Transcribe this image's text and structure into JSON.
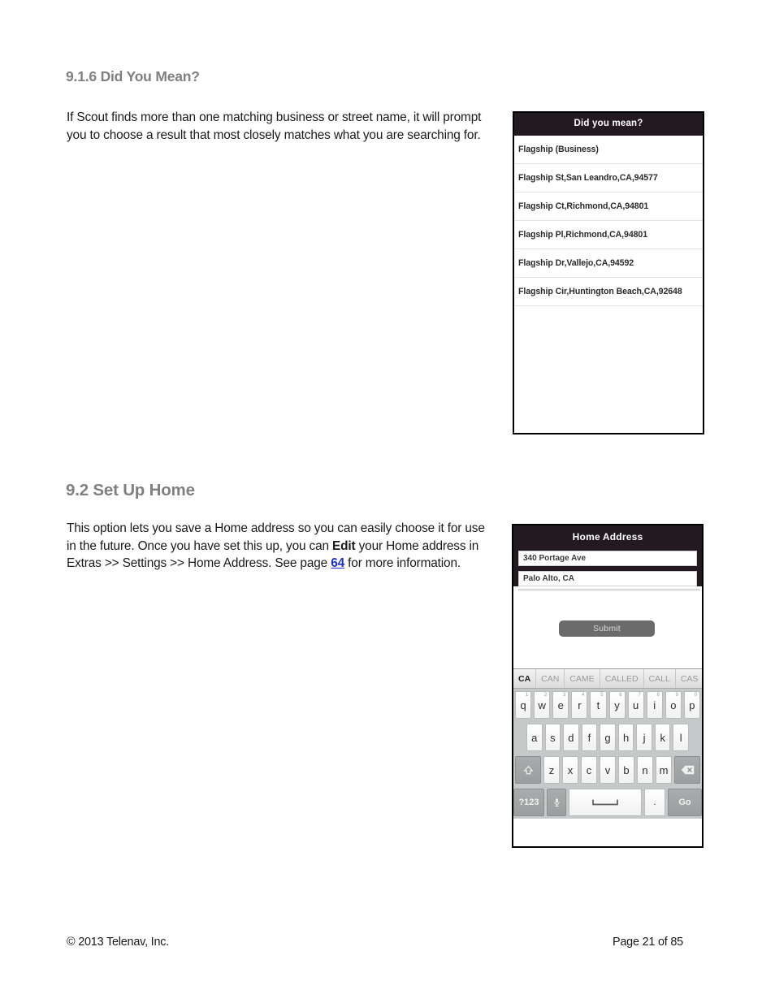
{
  "document": {
    "sections": [
      {
        "number_title": "9.1.6 Did You Mean?",
        "paragraph": "If Scout finds more than one matching business or street name, it will prompt you to choose a result that most closely matches what you are searching for."
      },
      {
        "number_title": "9.2 Set Up Home",
        "paragraph_part1": "This option lets you save a Home address so you can easily choose it for use in the future. Once you have set this up, you can ",
        "paragraph_bold": "Edit",
        "paragraph_part2": " your Home address in Extras >> Settings >> Home Address. See page ",
        "page_link": "64",
        "paragraph_part3": " for more information."
      }
    ],
    "footer": {
      "copyright": "© 2013 Telenav, Inc.",
      "page_number": "Page 21 of 85"
    }
  },
  "screenshot_did_you_mean": {
    "header_title": "Did you mean?",
    "results": [
      "Flagship (Business)",
      "Flagship St,San Leandro,CA,94577",
      "Flagship Ct,Richmond,CA,94801",
      "Flagship Pl,Richmond,CA,94801",
      "Flagship Dr,Vallejo,CA,94592",
      "Flagship Cir,Huntington Beach,CA,92648"
    ]
  },
  "screenshot_home_address": {
    "header_title": "Home Address",
    "address_field_value": "340 Portage Ave",
    "city_field_value": "Palo Alto, CA",
    "autocomplete_suggestion": "PALO ALTO, CA",
    "submit_label": "Submit",
    "keyboard": {
      "suggestions": [
        "CA",
        "CAN",
        "CAME",
        "CALLED",
        "CALL",
        "CAS",
        "..."
      ],
      "active_suggestion": "CA",
      "row1": [
        {
          "key": "q",
          "num": "1"
        },
        {
          "key": "w",
          "num": "2"
        },
        {
          "key": "e",
          "num": "3"
        },
        {
          "key": "r",
          "num": "4"
        },
        {
          "key": "t",
          "num": "5"
        },
        {
          "key": "y",
          "num": "6"
        },
        {
          "key": "u",
          "num": "7"
        },
        {
          "key": "i",
          "num": "8"
        },
        {
          "key": "o",
          "num": "9"
        },
        {
          "key": "p",
          "num": "0"
        }
      ],
      "row2": [
        "a",
        "s",
        "d",
        "f",
        "g",
        "h",
        "j",
        "k",
        "l"
      ],
      "row3": [
        "z",
        "x",
        "c",
        "v",
        "b",
        "n",
        "m"
      ],
      "shift_label": "shift-icon",
      "backspace_label": "backspace-icon",
      "symbols_label": "?123",
      "mic_label": "microphone-icon",
      "space_label": "space-icon",
      "period_label": ".",
      "go_label": "Go"
    }
  },
  "colors": {
    "header_bar": "#221a20",
    "heading_gray": "#808080",
    "link_blue": "#1a2fd0",
    "keyboard_bg": "#c6c9ca",
    "submit_gray": "#6b6b6b"
  }
}
